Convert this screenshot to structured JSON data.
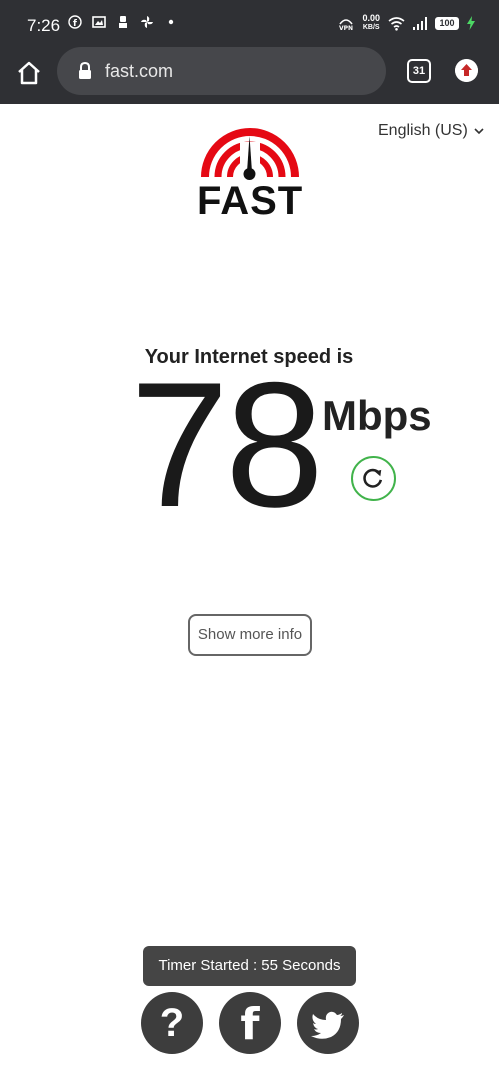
{
  "status_bar": {
    "time": "7:26",
    "net_speed_value": "0.00",
    "net_speed_unit": "KB/S",
    "battery_level": "100"
  },
  "browser": {
    "url": "fast.com",
    "tab_count": "31"
  },
  "page": {
    "language": "English (US)",
    "logo_text": "FAST",
    "headline": "Your Internet speed is",
    "speed_value": "78",
    "speed_unit": "Mbps",
    "more_info_label": "Show more info"
  },
  "toast": {
    "message": "Timer Started : 55 Seconds"
  },
  "footer": {
    "help_glyph": "?",
    "facebook_glyph": "f"
  },
  "colors": {
    "brand_red": "#e50914",
    "refresh_green": "#41b34b",
    "chrome_bar": "#2f3034"
  }
}
